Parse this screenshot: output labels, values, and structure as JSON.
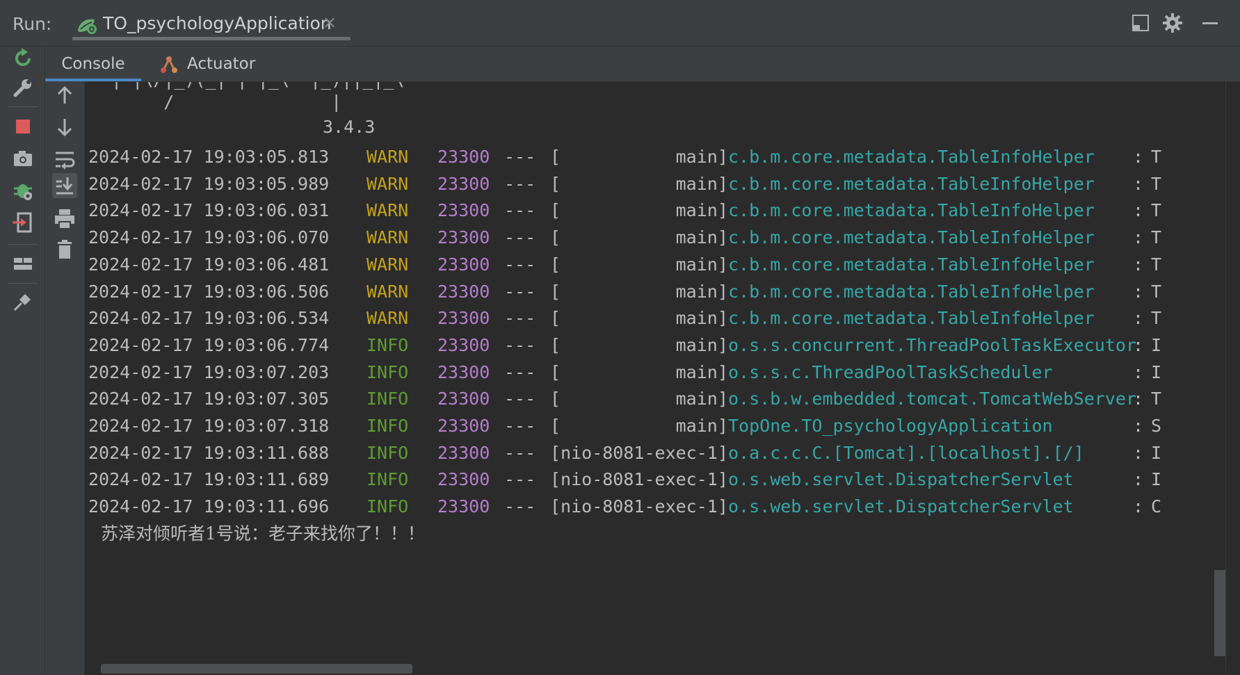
{
  "run_bar": {
    "label": "Run:",
    "tab_title": "TO_psychologyApplication",
    "close_glyph": "×",
    "actions": [
      "layout-icon",
      "gear-icon",
      "minimize-icon"
    ]
  },
  "tabs": [
    {
      "label": "Console",
      "icon": "console",
      "active": true
    },
    {
      "label": "Actuator",
      "icon": "actuator-icon",
      "active": false
    }
  ],
  "left_toolbar": [
    "rerun-icon",
    "wrench-icon",
    "stop-icon",
    "camera-icon",
    "debug-settings-icon",
    "exit-icon",
    "layout-icon",
    "pin-icon"
  ],
  "console_toolbar": [
    "arrow-up-icon",
    "arrow-down-icon",
    "soft-wrap-icon",
    "scroll-to-end-icon",
    "print-icon",
    "trash-icon"
  ],
  "console": {
    "banner_line1": " | |\\/|_)(_| | |_\\  |_)||_|_\\",
    "banner_line2": "      /               |",
    "version": "3.4.3",
    "logs": [
      {
        "time": "2024-02-17 19:03:05.813",
        "level": "WARN",
        "pid": "23300",
        "sep": "---",
        "thread": "[           main]",
        "logger": "c.b.m.core.metadata.TableInfoHelper",
        "colon": ":",
        "msg": "T"
      },
      {
        "time": "2024-02-17 19:03:05.989",
        "level": "WARN",
        "pid": "23300",
        "sep": "---",
        "thread": "[           main]",
        "logger": "c.b.m.core.metadata.TableInfoHelper",
        "colon": ":",
        "msg": "T"
      },
      {
        "time": "2024-02-17 19:03:06.031",
        "level": "WARN",
        "pid": "23300",
        "sep": "---",
        "thread": "[           main]",
        "logger": "c.b.m.core.metadata.TableInfoHelper",
        "colon": ":",
        "msg": "T"
      },
      {
        "time": "2024-02-17 19:03:06.070",
        "level": "WARN",
        "pid": "23300",
        "sep": "---",
        "thread": "[           main]",
        "logger": "c.b.m.core.metadata.TableInfoHelper",
        "colon": ":",
        "msg": "T"
      },
      {
        "time": "2024-02-17 19:03:06.481",
        "level": "WARN",
        "pid": "23300",
        "sep": "---",
        "thread": "[           main]",
        "logger": "c.b.m.core.metadata.TableInfoHelper",
        "colon": ":",
        "msg": "T"
      },
      {
        "time": "2024-02-17 19:03:06.506",
        "level": "WARN",
        "pid": "23300",
        "sep": "---",
        "thread": "[           main]",
        "logger": "c.b.m.core.metadata.TableInfoHelper",
        "colon": ":",
        "msg": "T"
      },
      {
        "time": "2024-02-17 19:03:06.534",
        "level": "WARN",
        "pid": "23300",
        "sep": "---",
        "thread": "[           main]",
        "logger": "c.b.m.core.metadata.TableInfoHelper",
        "colon": ":",
        "msg": "T"
      },
      {
        "time": "2024-02-17 19:03:06.774",
        "level": "INFO",
        "pid": "23300",
        "sep": "---",
        "thread": "[           main]",
        "logger": "o.s.s.concurrent.ThreadPoolTaskExecutor",
        "colon": ":",
        "msg": "I"
      },
      {
        "time": "2024-02-17 19:03:07.203",
        "level": "INFO",
        "pid": "23300",
        "sep": "---",
        "thread": "[           main]",
        "logger": "o.s.s.c.ThreadPoolTaskScheduler",
        "colon": ":",
        "msg": "I"
      },
      {
        "time": "2024-02-17 19:03:07.305",
        "level": "INFO",
        "pid": "23300",
        "sep": "---",
        "thread": "[           main]",
        "logger": "o.s.b.w.embedded.tomcat.TomcatWebServer",
        "colon": ":",
        "msg": "T"
      },
      {
        "time": "2024-02-17 19:03:07.318",
        "level": "INFO",
        "pid": "23300",
        "sep": "---",
        "thread": "[           main]",
        "logger": "TopOne.TO_psychologyApplication",
        "colon": ":",
        "msg": "S"
      },
      {
        "time": "2024-02-17 19:03:11.688",
        "level": "INFO",
        "pid": "23300",
        "sep": "---",
        "thread": "[nio-8081-exec-1]",
        "logger": "o.a.c.c.C.[Tomcat].[localhost].[/]",
        "colon": ":",
        "msg": "I"
      },
      {
        "time": "2024-02-17 19:03:11.689",
        "level": "INFO",
        "pid": "23300",
        "sep": "---",
        "thread": "[nio-8081-exec-1]",
        "logger": "o.s.web.servlet.DispatcherServlet",
        "colon": ":",
        "msg": "I"
      },
      {
        "time": "2024-02-17 19:03:11.696",
        "level": "INFO",
        "pid": "23300",
        "sep": "---",
        "thread": "[nio-8081-exec-1]",
        "logger": "o.s.web.servlet.DispatcherServlet",
        "colon": ":",
        "msg": "C"
      }
    ],
    "output_line": "苏泽对倾听者1号说：老子来找你了！！！"
  },
  "colors": {
    "warn": "#c3a21d",
    "info": "#5e9d32",
    "pid": "#b57ecc",
    "logger": "#37a6a6",
    "accent": "#4a88c7"
  }
}
